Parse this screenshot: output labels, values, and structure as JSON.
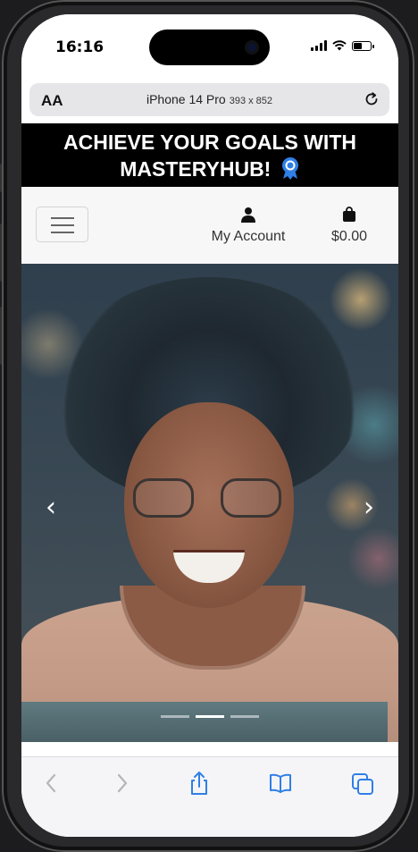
{
  "status_bar": {
    "time": "16:16"
  },
  "url_bar": {
    "aa_label": "AA",
    "title": "iPhone 14 Pro",
    "dimensions": "393 x 852"
  },
  "banner": {
    "text": "ACHIEVE YOUR GOALS WITH MASTERYHUB!",
    "icon": "award-ribbon-icon"
  },
  "navbar": {
    "account_label": "My Account",
    "cart_total": "$0.00"
  },
  "carousel": {
    "slide_count": 3,
    "active_index": 1,
    "image_description_alt": "hero-slide"
  },
  "colors": {
    "banner_bg": "#000000",
    "banner_text": "#ffffff",
    "award_blue": "#2f7fe6",
    "safari_blue": "#2f7fe6"
  }
}
